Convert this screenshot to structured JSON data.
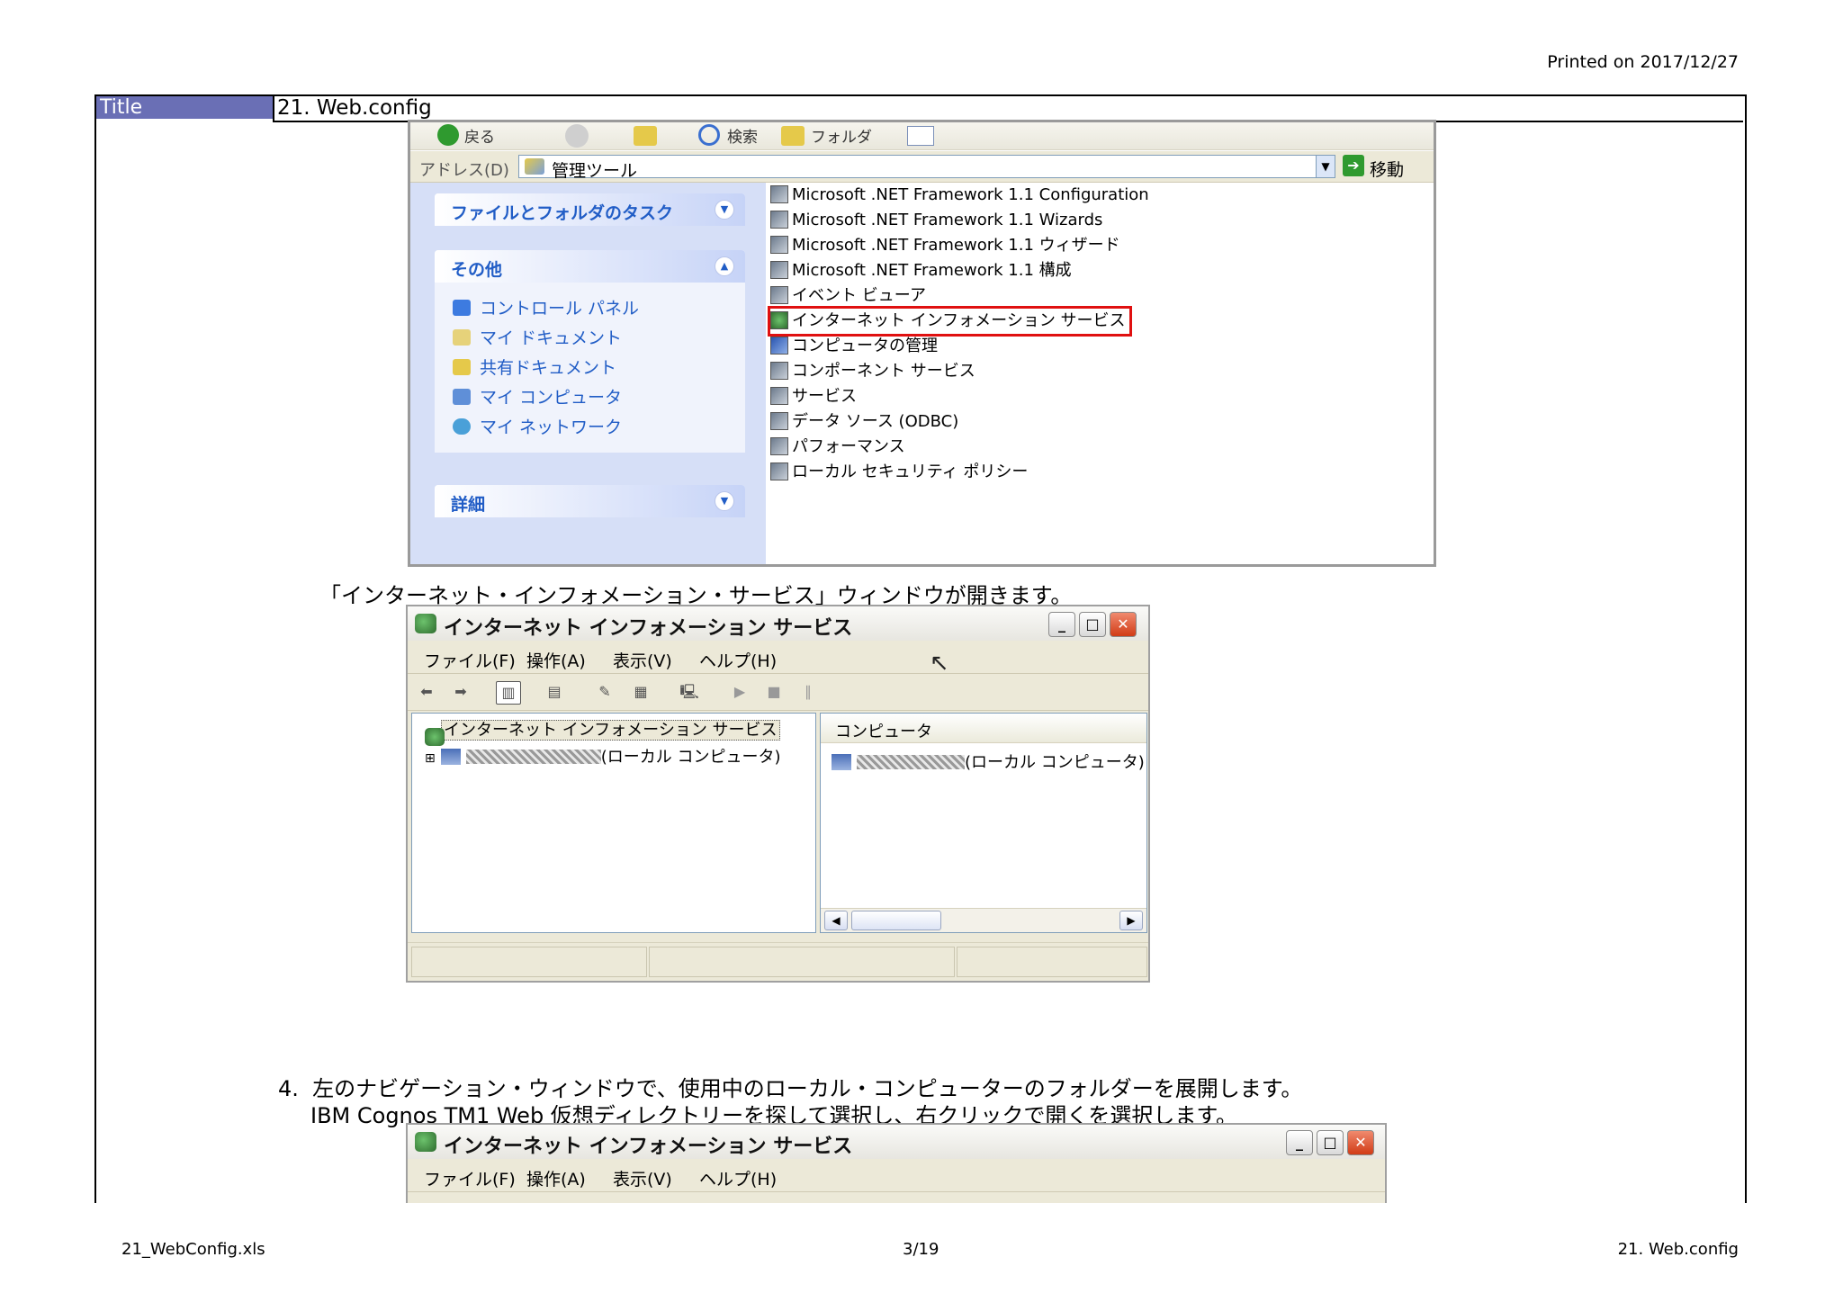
{
  "header": {
    "printed": "Printed on 2017/12/27"
  },
  "title_row": {
    "label": "Title",
    "value": "21. Web.config"
  },
  "explorer": {
    "toolbar": {
      "back": "戻る",
      "search": "検索",
      "folder": "フォルダ"
    },
    "address": {
      "label": "アドレス(D)",
      "value": "管理ツール",
      "go": "移動"
    },
    "task_pane": {
      "box1_title": "ファイルとフォルダのタスク",
      "box2_title": "その他",
      "box2_links": [
        "コントロール パネル",
        "マイ ドキュメント",
        "共有ドキュメント",
        "マイ コンピュータ",
        "マイ ネットワーク"
      ],
      "box3_title": "詳細"
    },
    "files": [
      "Microsoft .NET Framework 1.1 Configuration",
      "Microsoft .NET Framework 1.1 Wizards",
      "Microsoft .NET Framework 1.1 ウィザード",
      "Microsoft .NET Framework 1.1 構成",
      "イベント ビューア",
      "インターネット インフォメーション サービス",
      "コンピュータの管理",
      "コンポーネント サービス",
      "サービス",
      "データ ソース (ODBC)",
      "パフォーマンス",
      "ローカル セキュリティ ポリシー"
    ]
  },
  "caption1": "「インターネット・インフォメーション・サービス」ウィンドウが開きます。",
  "iis_window": {
    "title": "インターネット インフォメーション サービス",
    "menu": [
      "ファイル(F)",
      "操作(A)",
      "表示(V)",
      "ヘルプ(H)"
    ],
    "tree_root": "インターネット インフォメーション サービス",
    "tree_child_suffix": "(ローカル コンピュータ)",
    "list_header": "コンピュータ",
    "list_item_suffix": "(ローカル コンピュータ)"
  },
  "step4": {
    "number": "4.",
    "line1": "左のナビゲーション・ウィンドウで、使用中のローカル・コンピューターのフォルダーを展開します。",
    "line2": "IBM Cognos TM1 Web 仮想ディレクトリーを探して選択し、右クリックで開くを選択します。"
  },
  "iis_window2": {
    "title": "インターネット インフォメーション サービス",
    "menu": [
      "ファイル(F)",
      "操作(A)",
      "表示(V)",
      "ヘルプ(H)"
    ]
  },
  "footer": {
    "left": "21_WebConfig.xls",
    "center": "3/19",
    "right": "21. Web.config"
  }
}
